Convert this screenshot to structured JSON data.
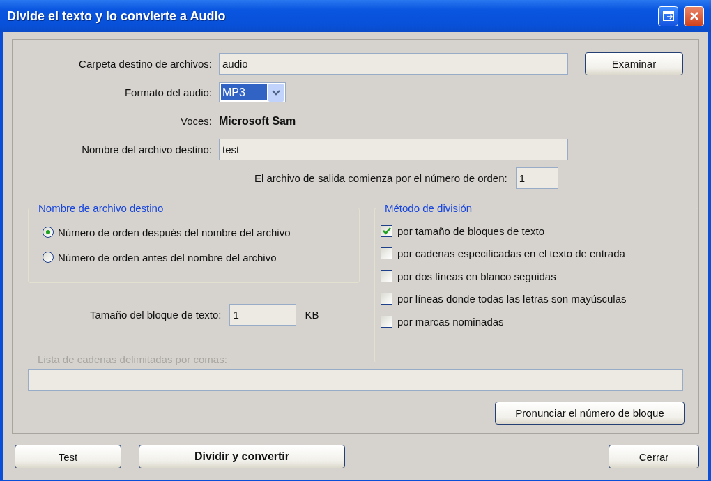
{
  "window": {
    "title": "Divide el texto y lo convierte a Audio"
  },
  "fields": [
    {
      "label": "Carpeta destino de archivos:",
      "kind": "text",
      "value": "audio"
    },
    {
      "label": "Formato del audio:",
      "kind": "select",
      "value": "MP3"
    },
    {
      "label": "Voces:",
      "kind": "static",
      "value": "Microsoft Sam"
    },
    {
      "label": "Nombre del archivo destino:",
      "kind": "text",
      "value": "test"
    }
  ],
  "browse_button": "Examinar",
  "start_number": {
    "label": "El archivo de salida comienza por el número de orden:",
    "value": "1"
  },
  "name_group": {
    "title": "Nombre de archivo destino",
    "options": [
      {
        "label": "Número de orden después del nombre del archivo",
        "selected": true
      },
      {
        "label": "Número de orden antes del nombre del archivo",
        "selected": false
      }
    ]
  },
  "block_size": {
    "label": "Tamaño del bloque de texto:",
    "value": "1",
    "unit": "KB"
  },
  "split_group": {
    "title": "Método de división",
    "options": [
      {
        "label": "por tamaño de bloques de texto",
        "checked": true
      },
      {
        "label": "por cadenas especificadas en el texto de entrada",
        "checked": false
      },
      {
        "label": "por dos líneas en blanco seguidas",
        "checked": false
      },
      {
        "label": "por líneas donde todas las letras son mayúsculas",
        "checked": false
      },
      {
        "label": "por marcas nominadas",
        "checked": false
      }
    ]
  },
  "strings_list": {
    "label": "Lista de cadenas delimitadas por comas:",
    "disabled": true
  },
  "speak_button": "Pronunciar el número de bloque",
  "buttons": [
    {
      "label": "Test",
      "bold": false
    },
    {
      "label": "Dividir y convertir",
      "bold": true
    },
    {
      "label": "Cerrar",
      "bold": false
    }
  ]
}
